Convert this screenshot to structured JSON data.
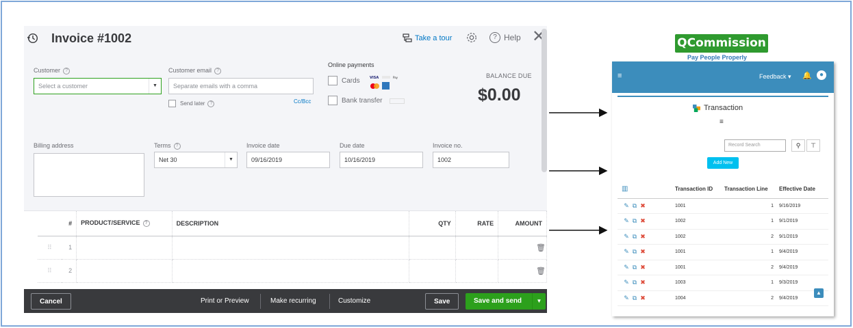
{
  "invoice": {
    "title": "Invoice #1002",
    "take_tour": "Take a tour",
    "help": "Help",
    "customer_label": "Customer",
    "customer_placeholder": "Select a customer",
    "email_label": "Customer email",
    "email_placeholder": "Separate emails with a comma",
    "send_later": "Send later",
    "cc_bcc": "Cc/Bcc",
    "online_payments": "Online payments",
    "cards": "Cards",
    "bank_transfer": "Bank transfer",
    "balance_label": "BALANCE DUE",
    "balance_value": "$0.00",
    "billing_label": "Billing address",
    "terms_label": "Terms",
    "terms_value": "Net 30",
    "invoice_date_label": "Invoice date",
    "invoice_date_value": "09/16/2019",
    "due_date_label": "Due date",
    "due_date_value": "10/16/2019",
    "invoice_no_label": "Invoice no.",
    "invoice_no_value": "1002",
    "columns": [
      "#",
      "PRODUCT/SERVICE",
      "DESCRIPTION",
      "QTY",
      "RATE",
      "AMOUNT"
    ],
    "rows": [
      "1",
      "2"
    ],
    "footer": {
      "cancel": "Cancel",
      "print": "Print or Preview",
      "recurring": "Make recurring",
      "customize": "Customize",
      "save": "Save",
      "save_send": "Save and send"
    }
  },
  "qcommission": {
    "logo": "QCommission",
    "tagline": "Pay People Properly",
    "feedback": "Feedback ▾",
    "page_title": "Transaction",
    "search_placeholder": "Record Search",
    "add_new": "Add New",
    "columns": [
      "Transaction ID",
      "Transaction Line",
      "Effective Date"
    ],
    "rows": [
      {
        "id": "1001",
        "line": "1",
        "date": "9/16/2019"
      },
      {
        "id": "1002",
        "line": "1",
        "date": "9/1/2019"
      },
      {
        "id": "1002",
        "line": "2",
        "date": "9/1/2019"
      },
      {
        "id": "1001",
        "line": "1",
        "date": "9/4/2019"
      },
      {
        "id": "1001",
        "line": "2",
        "date": "9/4/2019"
      },
      {
        "id": "1003",
        "line": "1",
        "date": "9/3/2019"
      },
      {
        "id": "1004",
        "line": "2",
        "date": "9/4/2019"
      }
    ]
  },
  "colors": {
    "accent_green": "#2ca01c",
    "qc_blue": "#3c8dbc",
    "link_blue": "#0077c5"
  }
}
